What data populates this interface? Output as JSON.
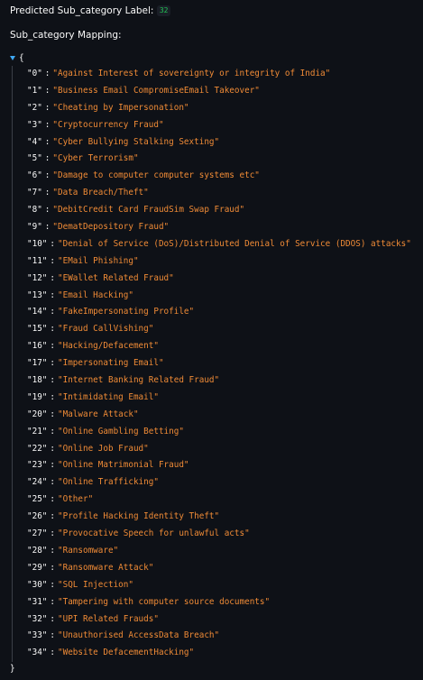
{
  "prediction": {
    "label": "Predicted Sub_category Label:",
    "value": "32"
  },
  "mapping": {
    "title": "Sub_category Mapping:",
    "open_brace": "{",
    "close_brace": "}",
    "entries": [
      {
        "key": "\"0\"",
        "value": "\"Against Interest of sovereignty or integrity of India\""
      },
      {
        "key": "\"1\"",
        "value": "\"Business Email CompromiseEmail Takeover\""
      },
      {
        "key": "\"2\"",
        "value": "\"Cheating by Impersonation\""
      },
      {
        "key": "\"3\"",
        "value": "\"Cryptocurrency Fraud\""
      },
      {
        "key": "\"4\"",
        "value": "\"Cyber Bullying  Stalking  Sexting\""
      },
      {
        "key": "\"5\"",
        "value": "\"Cyber Terrorism\""
      },
      {
        "key": "\"6\"",
        "value": "\"Damage to computer computer systems etc\""
      },
      {
        "key": "\"7\"",
        "value": "\"Data Breach/Theft\""
      },
      {
        "key": "\"8\"",
        "value": "\"DebitCredit Card FraudSim Swap Fraud\""
      },
      {
        "key": "\"9\"",
        "value": "\"DematDepository Fraud\""
      },
      {
        "key": "\"10\"",
        "value": "\"Denial of Service (DoS)/Distributed Denial of Service (DDOS) attacks\""
      },
      {
        "key": "\"11\"",
        "value": "\"EMail Phishing\""
      },
      {
        "key": "\"12\"",
        "value": "\"EWallet Related Fraud\""
      },
      {
        "key": "\"13\"",
        "value": "\"Email Hacking\""
      },
      {
        "key": "\"14\"",
        "value": "\"FakeImpersonating Profile\""
      },
      {
        "key": "\"15\"",
        "value": "\"Fraud CallVishing\""
      },
      {
        "key": "\"16\"",
        "value": "\"Hacking/Defacement\""
      },
      {
        "key": "\"17\"",
        "value": "\"Impersonating Email\""
      },
      {
        "key": "\"18\"",
        "value": "\"Internet Banking Related Fraud\""
      },
      {
        "key": "\"19\"",
        "value": "\"Intimidating Email\""
      },
      {
        "key": "\"20\"",
        "value": "\"Malware Attack\""
      },
      {
        "key": "\"21\"",
        "value": "\"Online Gambling  Betting\""
      },
      {
        "key": "\"22\"",
        "value": "\"Online Job Fraud\""
      },
      {
        "key": "\"23\"",
        "value": "\"Online Matrimonial Fraud\""
      },
      {
        "key": "\"24\"",
        "value": "\"Online Trafficking\""
      },
      {
        "key": "\"25\"",
        "value": "\"Other\""
      },
      {
        "key": "\"26\"",
        "value": "\"Profile Hacking Identity Theft\""
      },
      {
        "key": "\"27\"",
        "value": "\"Provocative Speech for unlawful acts\""
      },
      {
        "key": "\"28\"",
        "value": "\"Ransomware\""
      },
      {
        "key": "\"29\"",
        "value": "\"Ransomware Attack\""
      },
      {
        "key": "\"30\"",
        "value": "\"SQL Injection\""
      },
      {
        "key": "\"31\"",
        "value": "\"Tampering with computer source documents\""
      },
      {
        "key": "\"32\"",
        "value": "\"UPI Related Frauds\""
      },
      {
        "key": "\"33\"",
        "value": "\"Unauthorised AccessData Breach\""
      },
      {
        "key": "\"34\"",
        "value": "\"Website DefacementHacking\""
      }
    ]
  },
  "colors": {
    "background": "#0e1117",
    "text": "#fafafa",
    "string_value": "#f08b36",
    "badge_text": "#21c354",
    "toggle": "#3fa9f5"
  }
}
